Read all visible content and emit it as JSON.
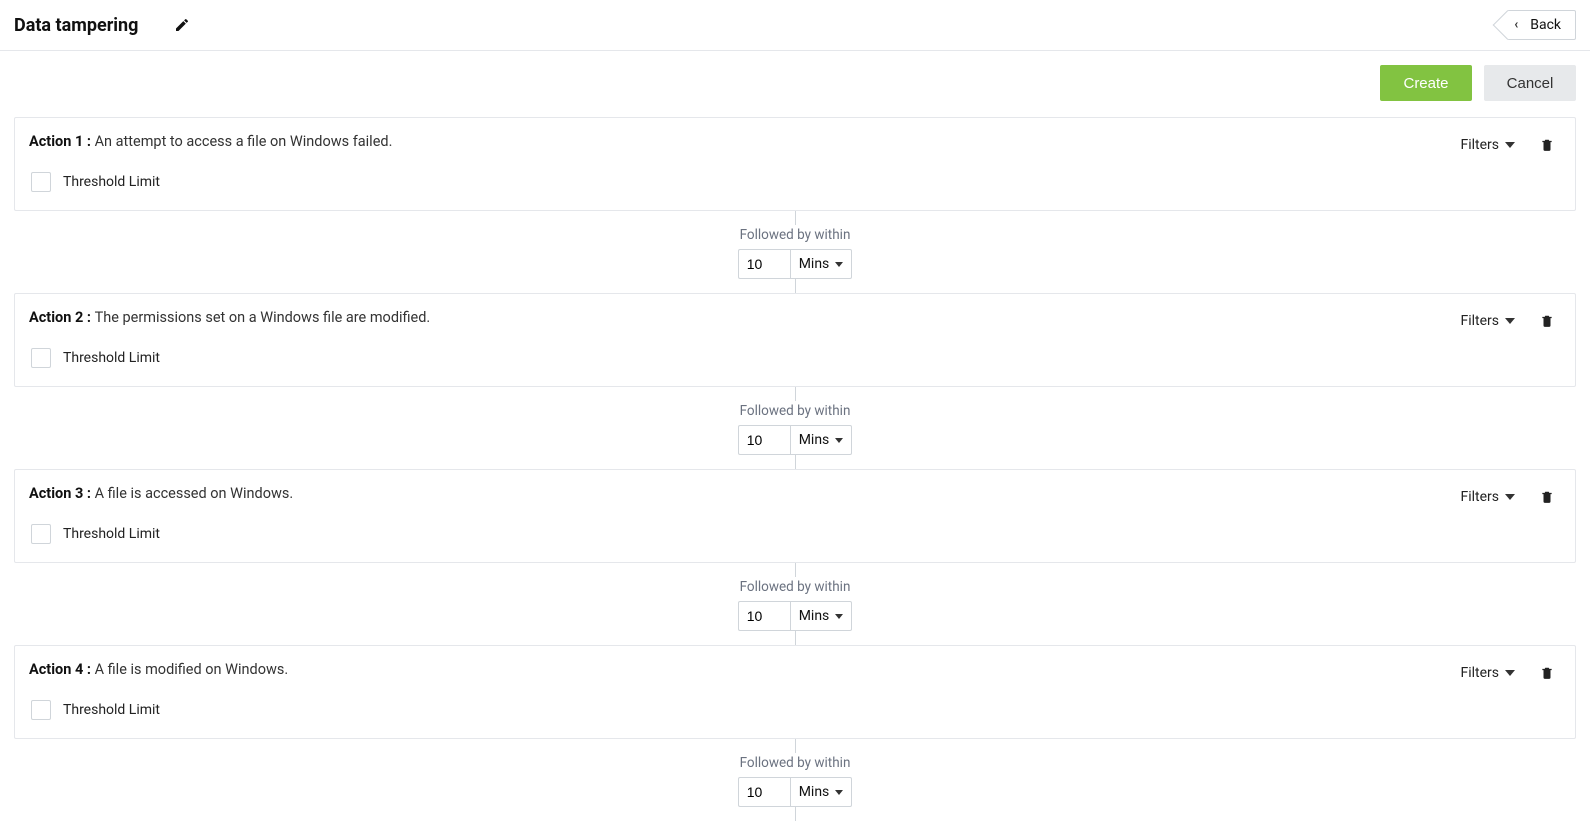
{
  "header": {
    "title": "Data tampering",
    "back_label": "Back"
  },
  "buttons": {
    "create": "Create",
    "cancel": "Cancel"
  },
  "labels": {
    "filters": "Filters",
    "threshold": "Threshold Limit",
    "followed_by": "Followed by within",
    "unit": "Mins"
  },
  "actions": [
    {
      "label": "Action 1 :",
      "description": "An attempt to access a file on Windows failed.",
      "followed_value": "10"
    },
    {
      "label": "Action 2 :",
      "description": "The permissions set on a Windows file are modified.",
      "followed_value": "10"
    },
    {
      "label": "Action 3 :",
      "description": "A file is accessed on Windows.",
      "followed_value": "10"
    },
    {
      "label": "Action 4 :",
      "description": "A file is modified on Windows.",
      "followed_value": "10"
    }
  ]
}
